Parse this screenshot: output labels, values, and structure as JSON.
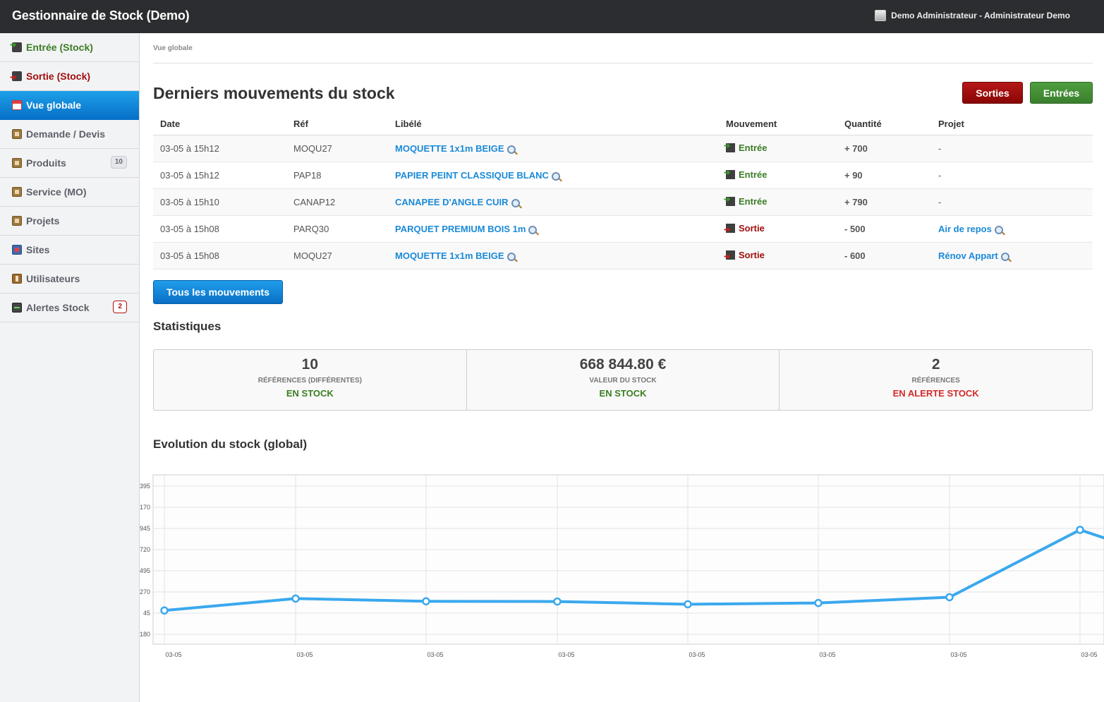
{
  "app": {
    "title": "Gestionnaire de Stock (Demo)",
    "user": "Demo Administrateur - Administrateur Demo"
  },
  "sidebar": {
    "items": [
      {
        "label": "Entrée (Stock)",
        "icon": "stock-in-icon"
      },
      {
        "label": "Sortie (Stock)",
        "icon": "stock-out-icon"
      },
      {
        "label": "Vue globale",
        "icon": "calendar-icon",
        "active": true
      },
      {
        "label": "Demande / Devis",
        "icon": "box-icon"
      },
      {
        "label": "Produits",
        "icon": "box-icon",
        "badge": "10"
      },
      {
        "label": "Service (MO)",
        "icon": "box-icon"
      },
      {
        "label": "Projets",
        "icon": "box-icon"
      },
      {
        "label": "Sites",
        "icon": "sites-icon"
      },
      {
        "label": "Utilisateurs",
        "icon": "user-icon"
      },
      {
        "label": "Alertes Stock",
        "icon": "alert-chart-icon",
        "badge": "2"
      }
    ]
  },
  "breadcrumb": "Vue globale",
  "movements": {
    "title": "Derniers mouvements du stock",
    "btn_sorties": "Sorties",
    "btn_entrees": "Entrées",
    "columns": [
      "Date",
      "Réf",
      "Libélé",
      "Mouvement",
      "Quantité",
      "Projet"
    ],
    "rows": [
      {
        "date": "03-05 à 15h12",
        "ref": "MOQU27",
        "label": "MOQUETTE 1x1m BEIGE",
        "mvt": "Entrée",
        "qty": "+ 700",
        "project": "-"
      },
      {
        "date": "03-05 à 15h12",
        "ref": "PAP18",
        "label": "PAPIER PEINT CLASSIQUE BLANC",
        "mvt": "Entrée",
        "qty": "+ 90",
        "project": "-"
      },
      {
        "date": "03-05 à 15h10",
        "ref": "CANAP12",
        "label": "CANAPEE D'ANGLE CUIR",
        "mvt": "Entrée",
        "qty": "+ 790",
        "project": "-"
      },
      {
        "date": "03-05 à 15h08",
        "ref": "PARQ30",
        "label": "PARQUET PREMIUM BOIS 1m",
        "mvt": "Sortie",
        "qty": "- 500",
        "project": "Air de repos"
      },
      {
        "date": "03-05 à 15h08",
        "ref": "MOQU27",
        "label": "MOQUETTE 1x1m BEIGE",
        "mvt": "Sortie",
        "qty": "- 600",
        "project": "Rénov Appart"
      }
    ],
    "all_button": "Tous les mouvements"
  },
  "stats": {
    "title": "Statistiques",
    "cards": [
      {
        "value": "10",
        "label": "RÉFÉRENCES (DIFFÉRENTES)",
        "sub": "EN STOCK"
      },
      {
        "value": "668 844.80 €",
        "label": "VALEUR DU STOCK",
        "sub": "EN STOCK"
      },
      {
        "value": "2",
        "label": "RÉFÉRENCES",
        "sub": "EN ALERTE STOCK"
      }
    ]
  },
  "colors": {
    "accent_blue": "#1a8ad8",
    "green": "#3b7d23",
    "red": "#a10e0e",
    "line": "#3aa8ee"
  },
  "chart_title": "Evolution du stock (global)",
  "chart_data": {
    "type": "line",
    "ytick_labels": [
      "395",
      "170",
      "945",
      "720",
      "495",
      "270",
      "45",
      "180"
    ],
    "x": [
      "03-05",
      "03-05",
      "03-05",
      "03-05",
      "03-05",
      "03-05",
      "03-05",
      "03-05"
    ],
    "values": [
      -10,
      120,
      90,
      88,
      58,
      72,
      135,
      870,
      700
    ],
    "grid": true,
    "legend": "none"
  }
}
